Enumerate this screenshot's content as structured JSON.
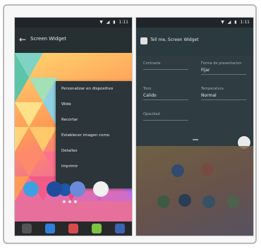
{
  "left_screen": {
    "statusbar": {
      "icons": [
        "wifi-icon",
        "signal-icon",
        "battery-icon"
      ],
      "time": "1:11"
    },
    "appbar": {
      "title": "Screen  Widget"
    },
    "menu": [
      "Personalizar en dispositivo",
      "Wide",
      "Recortar",
      "Establecer imagen como",
      "Detalles",
      "Imprimir"
    ]
  },
  "right_screen": {
    "statusbar": {
      "time": "1:11"
    },
    "toolbar": {
      "title": "Tell me, Screen Widget"
    },
    "fields": [
      {
        "label": "Contraste",
        "value": ""
      },
      {
        "label": "Forma de presentacion",
        "value": "Fijar"
      },
      {
        "label": "Tono",
        "value": "Calido"
      },
      {
        "label": "Temperatura",
        "value": "Normal"
      },
      {
        "label": "Opacidad",
        "value": ""
      }
    ]
  },
  "colors": {
    "appbar": "#263033",
    "menu_bg": "#2c3539",
    "right_panel": "#2f3d42"
  }
}
